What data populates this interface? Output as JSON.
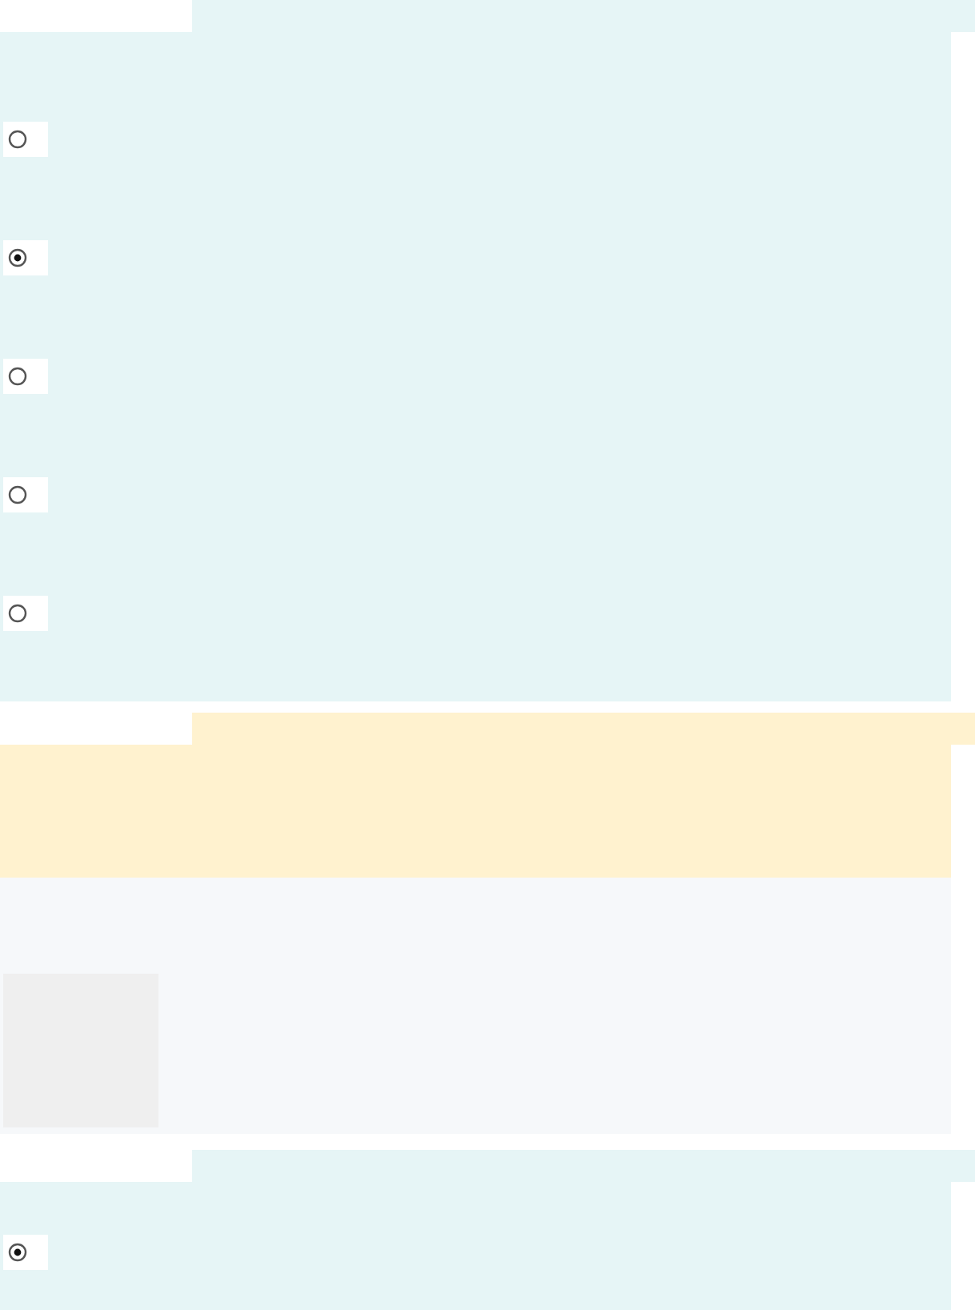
{
  "sections": [
    {
      "kind": "choice",
      "options": [
        {
          "selected": false
        },
        {
          "selected": true
        },
        {
          "selected": false
        },
        {
          "selected": false
        },
        {
          "selected": false
        }
      ]
    },
    {
      "kind": "notice"
    },
    {
      "kind": "choice",
      "options": [
        {
          "selected": true
        }
      ]
    }
  ]
}
